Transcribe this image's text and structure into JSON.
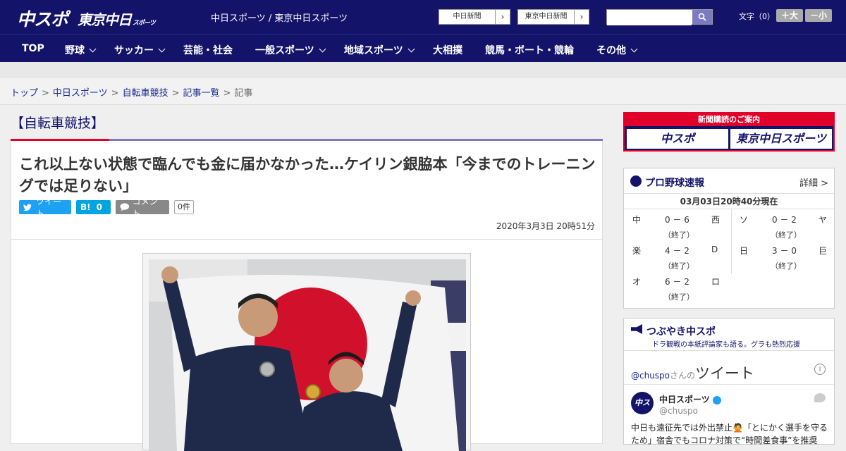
{
  "header": {
    "logo_chuspo": "中スポ",
    "logo_tokyo": "東京中日",
    "logo_tokyo_small": "スポーツ",
    "site_title": "中日スポーツ / 東京中日スポーツ",
    "ext_links": [
      "中日新聞",
      "東京中日新聞"
    ],
    "search_placeholder": "",
    "font_size_label": "文字（0）",
    "font_bigger": "＋大",
    "font_smaller": "－小"
  },
  "nav": {
    "items": [
      {
        "label": "TOP",
        "dropdown": false
      },
      {
        "label": "野球",
        "dropdown": true
      },
      {
        "label": "サッカー",
        "dropdown": true
      },
      {
        "label": "芸能・社会",
        "dropdown": false
      },
      {
        "label": "一般スポーツ",
        "dropdown": true
      },
      {
        "label": "地域スポーツ",
        "dropdown": true
      },
      {
        "label": "大相撲",
        "dropdown": false
      },
      {
        "label": "競馬・ボート・競輪",
        "dropdown": false
      },
      {
        "label": "その他",
        "dropdown": true
      }
    ]
  },
  "breadcrumb": {
    "items": [
      "トップ",
      "中日スポーツ",
      "自転車競技",
      "記事一覧"
    ],
    "current": "記事"
  },
  "article": {
    "category": "【自転車競技】",
    "headline": "これ以上ない状態で臨んでも金に届かなかった…ケイリン銀脇本「今までのトレーニングでは足りない」",
    "share_tweet": "ツイート",
    "share_hatena": "B!",
    "share_hatena_count": "0",
    "share_comment": "コメント",
    "comment_count": "0件",
    "date": "2020年3月3日 20時51分"
  },
  "sidebar": {
    "promo_title": "新聞購読のご案内",
    "promo_buttons": [
      "中スポ",
      "東京中日スポーツ"
    ],
    "baseball": {
      "title": "プロ野球速報",
      "more": "詳細 >",
      "as_of": "03月03日20時40分現在",
      "games": [
        {
          "home": "中",
          "score": "0 － 6",
          "away": "西",
          "status": "（終了）"
        },
        {
          "home": "ソ",
          "score": "0 － 2",
          "away": "ヤ",
          "status": "（終了）"
        },
        {
          "home": "楽",
          "score": "4 － 2",
          "away": "D",
          "status": "（終了）"
        },
        {
          "home": "日",
          "score": "3 － 0",
          "away": "巨",
          "status": "（終了）"
        },
        {
          "home": "オ",
          "score": "6 － 2",
          "away": "ロ",
          "status": "（終了）"
        }
      ]
    },
    "tweets": {
      "title": "つぶやき中スポ",
      "subtitle": "ドラ観戦の本紙評論家も語る。グラも熱烈応援",
      "handle_link": "@chuspo",
      "handle_suffix": "さんの",
      "handle_big": "ツイート",
      "tweet_name": "中日スポーツ",
      "tweet_at": "@chuspo",
      "avatar_text": "中スポ",
      "tweet_text": "中日も遠征先では外出禁止🙅「とにかく選手を守るため」宿舎でもコロナ対策で“時間差食事”を推奨"
    }
  },
  "colors": {
    "header_bg": "#14136a",
    "accent_red": "#e0002a",
    "accent_purple": "#7c7ac2"
  }
}
